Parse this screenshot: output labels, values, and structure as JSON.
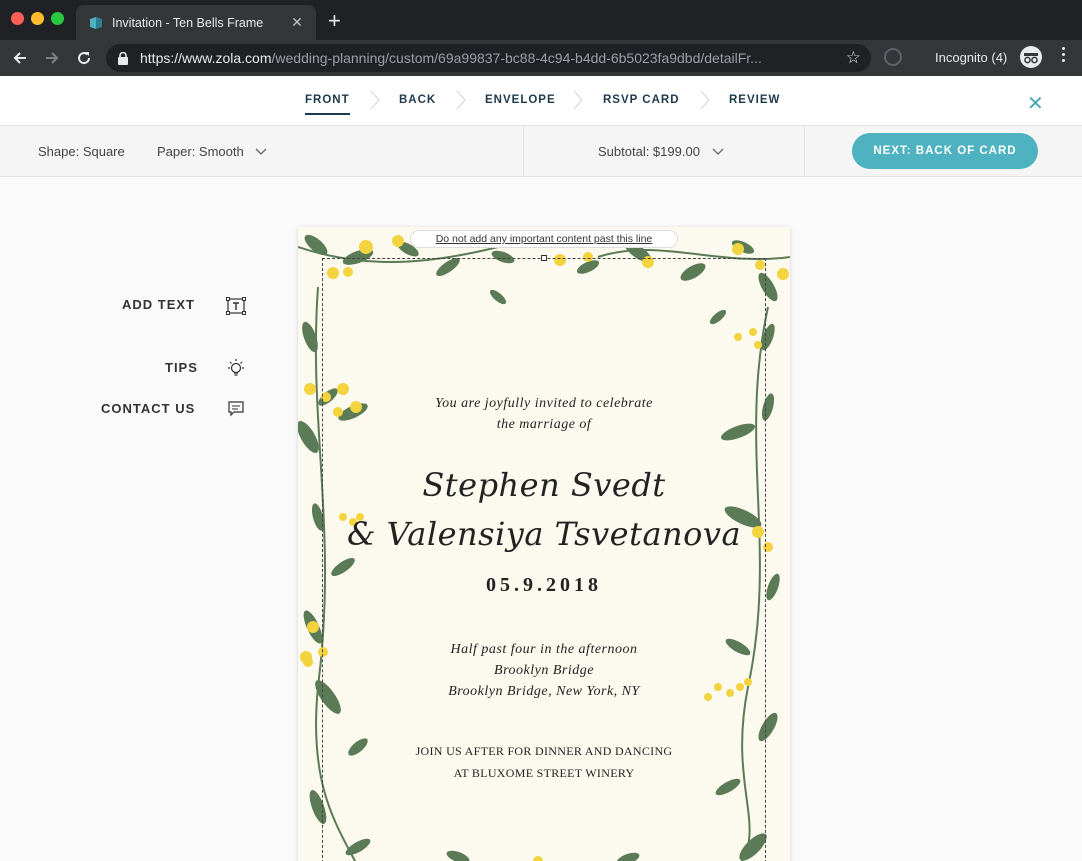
{
  "browser": {
    "tab_title": "Invitation - Ten Bells Frame",
    "tab_close": "✕",
    "new_tab": "+",
    "url_host": "https://www.zola.com",
    "url_path": "/wedding-planning/custom/69a99837-bc88-4c94-b4dd-6b5023fa9dbd/detailFr...",
    "incognito_label": "Incognito (4)"
  },
  "steps": [
    {
      "label": "FRONT",
      "active": true
    },
    {
      "label": "BACK",
      "active": false
    },
    {
      "label": "ENVELOPE",
      "active": false
    },
    {
      "label": "RSVP CARD",
      "active": false
    },
    {
      "label": "REVIEW",
      "active": false
    }
  ],
  "close_label": "✕",
  "options": {
    "shape": "Shape: Square",
    "paper": "Paper: Smooth",
    "subtotal": "Subtotal: $199.00",
    "next_button": "NEXT: BACK OF CARD"
  },
  "sidebar": {
    "add_text": "ADD TEXT",
    "tips": "TIPS",
    "contact": "CONTACT US"
  },
  "card": {
    "safe_line_label": "Do not add any important content past this line",
    "invite_line1": "You are joyfully invited to celebrate",
    "invite_line2": "the marriage of",
    "name1": "Stephen Svedt",
    "name2": "& Valensiya Tsvetanova",
    "date": "05.9.2018",
    "time": "Half past four in the afternoon",
    "venue": "Brooklyn Bridge",
    "location": "Brooklyn Bridge, New York, NY",
    "after_line1": "JOIN US AFTER FOR DINNER AND DANCING",
    "after_line2": "AT BLUXOME STREET WINERY"
  },
  "colors": {
    "accent": "#4fb2c0",
    "navy": "#1f3a4d",
    "leaf": "#5b7a56",
    "berry": "#f3d43f",
    "card_bg": "#fcf9ee"
  }
}
